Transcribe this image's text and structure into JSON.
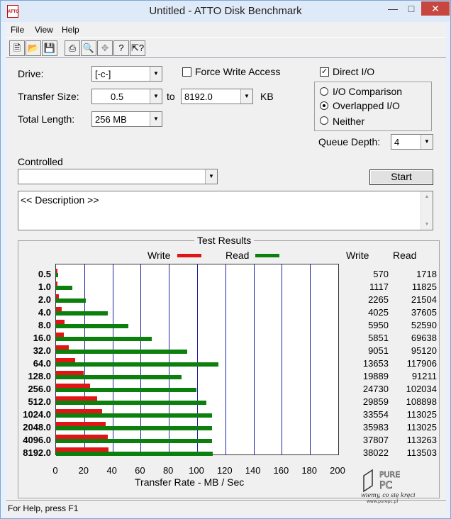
{
  "window": {
    "title": "Untitled - ATTO Disk Benchmark",
    "icon_text": "ATTO"
  },
  "menu": [
    "File",
    "View",
    "Help"
  ],
  "toolbar": [
    "new-icon",
    "open-icon",
    "save-icon",
    "print-icon",
    "print-preview-icon",
    "move-icon",
    "help-icon",
    "context-help-icon"
  ],
  "form": {
    "drive_label": "Drive:",
    "drive_value": "[-c-]",
    "force_write_label": "Force Write Access",
    "force_write_checked": false,
    "direct_io_label": "Direct I/O",
    "direct_io_checked": true,
    "transfer_size_label": "Transfer Size:",
    "transfer_from": "0.5",
    "to_label": "to",
    "transfer_to": "8192.0",
    "kb_label": "KB",
    "total_length_label": "Total Length:",
    "total_length_value": "256 MB",
    "io_comparison_label": "I/O Comparison",
    "overlapped_io_label": "Overlapped I/O",
    "neither_label": "Neither",
    "io_mode_selected": "Overlapped I/O",
    "queue_depth_label": "Queue Depth:",
    "queue_depth_value": "4",
    "controlled_label": "Controlled",
    "controlled_value": "",
    "start_label": "Start",
    "description_text": "<< Description >>"
  },
  "results": {
    "title": "Test Results",
    "legend_write": "Write",
    "legend_read": "Read",
    "col_write": "Write",
    "col_read": "Read",
    "xlabel": "Transfer Rate - MB / Sec"
  },
  "chart_data": {
    "type": "bar",
    "orientation": "horizontal",
    "categories": [
      "0.5",
      "1.0",
      "2.0",
      "4.0",
      "8.0",
      "16.0",
      "32.0",
      "64.0",
      "128.0",
      "256.0",
      "512.0",
      "1024.0",
      "2048.0",
      "4096.0",
      "8192.0"
    ],
    "series": [
      {
        "name": "Write",
        "color": "#e01616",
        "values": [
          570,
          1117,
          2265,
          4025,
          5950,
          5851,
          9051,
          13653,
          19889,
          24730,
          29859,
          33554,
          35983,
          37807,
          38022
        ]
      },
      {
        "name": "Read",
        "color": "#0c800c",
        "values": [
          1718,
          11825,
          21504,
          37605,
          52590,
          69638,
          95120,
          117906,
          91211,
          102034,
          108898,
          113025,
          113025,
          113263,
          113503
        ]
      }
    ],
    "value_units": "KB/s",
    "xlabel": "Transfer Rate - MB / Sec",
    "xticks": [
      "0",
      "20",
      "40",
      "60",
      "80",
      "100",
      "120",
      "140",
      "160",
      "180",
      "200"
    ],
    "xlim": [
      0,
      200
    ],
    "grid": true
  },
  "status": {
    "text": "For Help, press F1"
  },
  "watermark": {
    "brand": "PURE PC",
    "slogan": "wiemy, co się kręci",
    "url": "www.purepc.pl"
  }
}
